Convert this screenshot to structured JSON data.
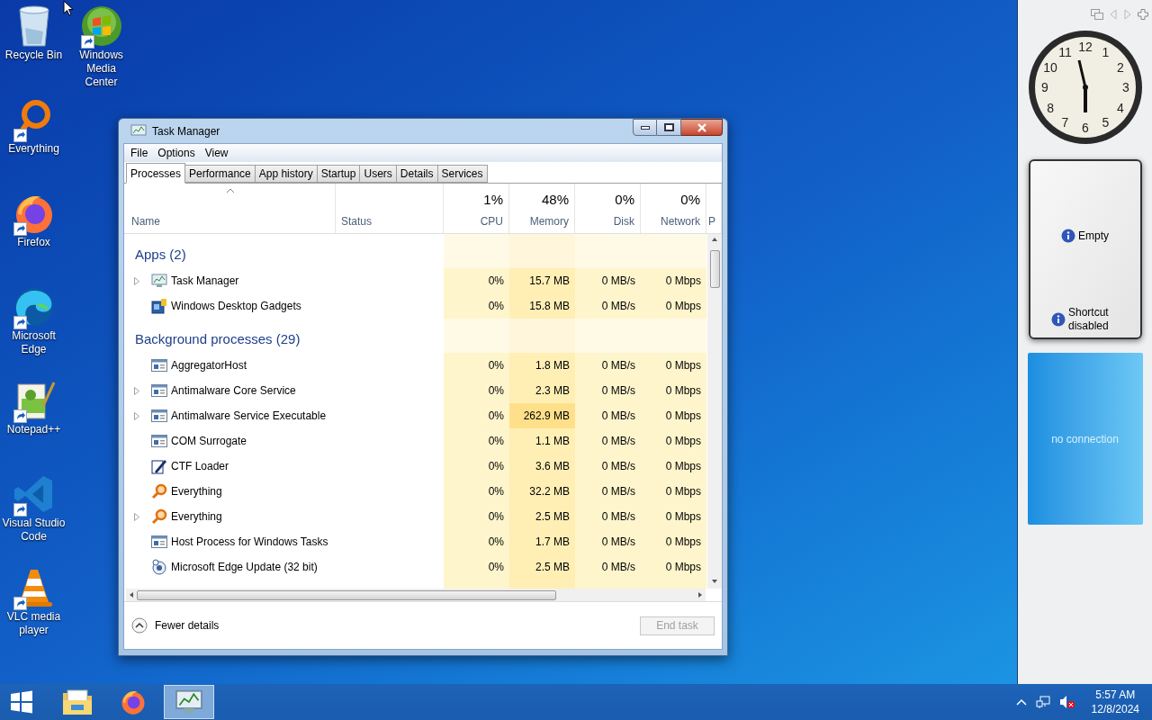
{
  "desktop_columns": [
    {
      "icons": [
        {
          "label": "Recycle Bin",
          "kind": "recycle",
          "shortcut": false
        },
        {
          "label": "Everything",
          "kind": "everything",
          "shortcut": true
        },
        {
          "label": "Firefox",
          "kind": "firefox",
          "shortcut": true
        },
        {
          "label": "Microsoft Edge",
          "kind": "edge",
          "shortcut": true
        },
        {
          "label": "Notepad++",
          "kind": "notepad",
          "shortcut": true
        },
        {
          "label": "Visual Studio Code",
          "kind": "vscode",
          "shortcut": true
        },
        {
          "label": "VLC media player",
          "kind": "vlc",
          "shortcut": true
        }
      ]
    },
    {
      "icons": [
        {
          "label": "Windows Media Center",
          "kind": "mediacenter",
          "shortcut": true
        }
      ]
    }
  ],
  "window": {
    "title": "Task Manager",
    "menu": [
      "File",
      "Options",
      "View"
    ],
    "tabs": [
      {
        "label": "Processes",
        "selected": true
      },
      {
        "label": "Performance",
        "selected": false
      },
      {
        "label": "App history",
        "selected": false
      },
      {
        "label": "Startup",
        "selected": false
      },
      {
        "label": "Users",
        "selected": false
      },
      {
        "label": "Details",
        "selected": false
      },
      {
        "label": "Services",
        "selected": false
      }
    ],
    "columns": [
      {
        "label": "Name",
        "sorted": true
      },
      {
        "label": "Status",
        "sorted": false
      },
      {
        "label": "CPU",
        "usage": "1%",
        "sorted": false
      },
      {
        "label": "Memory",
        "usage": "48%",
        "sorted": false
      },
      {
        "label": "Disk",
        "usage": "0%",
        "sorted": false
      },
      {
        "label": "Network",
        "usage": "0%",
        "sorted": false
      },
      {
        "label": "P",
        "sorted": false
      }
    ],
    "groups": [
      {
        "title": "Apps (2)",
        "rows": [
          {
            "name": "Task Manager",
            "kind": "taskmgr",
            "expandable": true,
            "cpu": "0%",
            "memory": "15.7 MB",
            "memory_heavy": false,
            "disk": "0 MB/s",
            "network": "0 Mbps"
          },
          {
            "name": "Windows Desktop Gadgets",
            "kind": "gadget",
            "expandable": false,
            "cpu": "0%",
            "memory": "15.8 MB",
            "memory_heavy": false,
            "disk": "0 MB/s",
            "network": "0 Mbps"
          }
        ]
      },
      {
        "title": "Background processes (29)",
        "rows": [
          {
            "name": "AggregatorHost",
            "kind": "window",
            "expandable": false,
            "cpu": "0%",
            "memory": "1.8 MB",
            "memory_heavy": false,
            "disk": "0 MB/s",
            "network": "0 Mbps"
          },
          {
            "name": "Antimalware Core Service",
            "kind": "window",
            "expandable": true,
            "cpu": "0%",
            "memory": "2.3 MB",
            "memory_heavy": false,
            "disk": "0 MB/s",
            "network": "0 Mbps"
          },
          {
            "name": "Antimalware Service Executable",
            "kind": "window",
            "expandable": true,
            "cpu": "0%",
            "memory": "262.9 MB",
            "memory_heavy": true,
            "disk": "0 MB/s",
            "network": "0 Mbps"
          },
          {
            "name": "COM Surrogate",
            "kind": "window",
            "expandable": false,
            "cpu": "0%",
            "memory": "1.1 MB",
            "memory_heavy": false,
            "disk": "0 MB/s",
            "network": "0 Mbps"
          },
          {
            "name": "CTF Loader",
            "kind": "pen",
            "expandable": false,
            "cpu": "0%",
            "memory": "3.6 MB",
            "memory_heavy": false,
            "disk": "0 MB/s",
            "network": "0 Mbps"
          },
          {
            "name": "Everything",
            "kind": "search",
            "expandable": false,
            "cpu": "0%",
            "memory": "32.2 MB",
            "memory_heavy": false,
            "disk": "0 MB/s",
            "network": "0 Mbps"
          },
          {
            "name": "Everything",
            "kind": "search",
            "expandable": true,
            "cpu": "0%",
            "memory": "2.5 MB",
            "memory_heavy": false,
            "disk": "0 MB/s",
            "network": "0 Mbps"
          },
          {
            "name": "Host Process for Windows Tasks",
            "kind": "window",
            "expandable": false,
            "cpu": "0%",
            "memory": "1.7 MB",
            "memory_heavy": false,
            "disk": "0 MB/s",
            "network": "0 Mbps"
          },
          {
            "name": "Microsoft Edge Update (32 bit)",
            "kind": "update",
            "expandable": false,
            "cpu": "0%",
            "memory": "2.5 MB",
            "memory_heavy": false,
            "disk": "0 MB/s",
            "network": "0 Mbps"
          }
        ]
      }
    ],
    "details_button": "Fewer details",
    "end_task": {
      "label": "End task",
      "disabled": true
    }
  },
  "gadgets": {
    "clock": {
      "numerals": [
        "11",
        "12",
        "1",
        "10",
        "2",
        "9",
        "3",
        "8",
        "4",
        "7",
        "6",
        "5"
      ]
    },
    "slideshow": {
      "messages": [
        "Empty",
        "Shortcut disabled"
      ]
    },
    "weather": {
      "message": "no connection"
    }
  },
  "taskbar": {
    "apps": [
      {
        "kind": "explorer",
        "selected": false
      },
      {
        "kind": "firefox",
        "selected": false
      },
      {
        "kind": "taskmgr",
        "selected": true
      }
    ],
    "tray": {
      "volume_muted": true,
      "time": "5:57 AM",
      "date": "12/8/2024"
    }
  }
}
